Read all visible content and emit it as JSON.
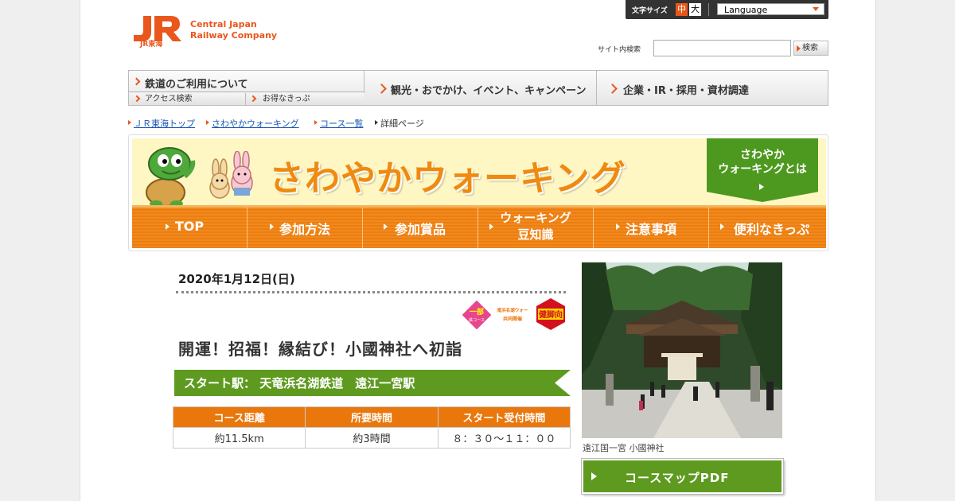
{
  "header": {
    "logo_tagline_1": "Central Japan",
    "logo_tagline_2": "Railway Company",
    "logo_mark_text": "JR東海",
    "font_size_label": "文字サイズ",
    "font_size_medium": "中",
    "font_size_large": "大",
    "language_select": "Language",
    "site_search_label": "サイト内検索",
    "search_placeholder": "",
    "search_button": "検索"
  },
  "global_nav": {
    "railway_use": "鉄道のご利用について",
    "access_search": "アクセス検索",
    "value_tickets": "お得なきっぷ",
    "tourism": "観光・おでかけ、イベント、キャンペーン",
    "corporate": "企業・IR・採用・資材調達"
  },
  "breadcrumb": [
    "ＪＲ東海トップ",
    "さわやかウォーキング",
    "コース一覧",
    "詳細ページ"
  ],
  "banner": {
    "title": "さわやかウォーキング",
    "about_line1": "さわやか",
    "about_line2": "ウォーキングとは",
    "nav": [
      {
        "label": "TOP"
      },
      {
        "label": "参加方法"
      },
      {
        "label": "参加賞品"
      },
      {
        "label_line1": "ウォーキング",
        "label_line2": "豆知識"
      },
      {
        "label": "注意事項"
      },
      {
        "label": "便利なきっぷ"
      }
    ]
  },
  "event": {
    "date": "2020年1月12日(日)",
    "badges": {
      "partial_course_top": "一部",
      "partial_course_bottom": "鉄コース",
      "joint_event_line1": "天竜浜名湖ウォーク",
      "joint_event_line2": "共同開催",
      "fitness_level": "健脚向"
    },
    "title": "開運！招福！縁結び！小國神社へ初詣",
    "start_station": "スタート駅：  天竜浜名湖鉄道　遠江一宮駅",
    "table": {
      "headers": [
        "コース距離",
        "所要時間",
        "スタート受付時間"
      ],
      "values": [
        "約11.5km",
        "約3時間",
        "８：３０～１１：００"
      ]
    }
  },
  "sidebar": {
    "photo_caption": "遠江国一宮 小國神社",
    "pdf_button": "コースマップPDF"
  },
  "colors": {
    "brand_orange": "#e9571d",
    "walking_orange": "#ef8a11",
    "walking_green": "#5e9a1f"
  }
}
